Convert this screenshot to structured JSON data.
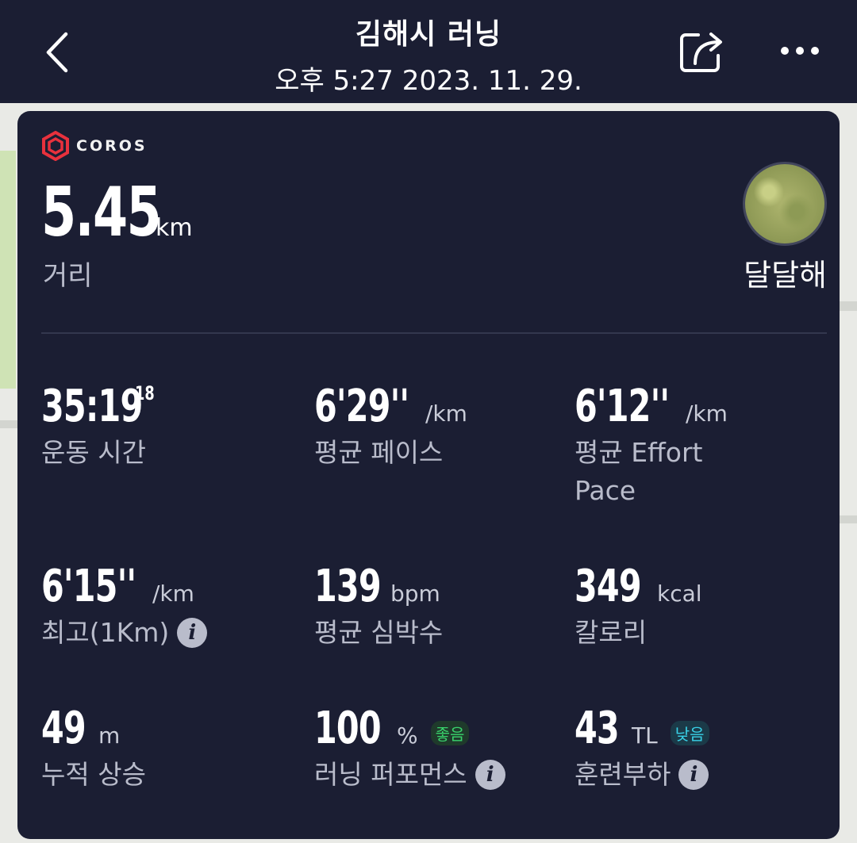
{
  "header": {
    "title": "김해시 러닝",
    "subtitle": "오후 5:27 2023. 11. 29."
  },
  "card": {
    "brand": "COROS",
    "brand_color": "#e8313d",
    "distance": {
      "value": "5.45",
      "unit": "km",
      "label": "거리"
    },
    "user": {
      "name": "달달해"
    },
    "stats": [
      {
        "value": "35:19",
        "sup": "18",
        "unit": "",
        "label": "운동 시간"
      },
      {
        "value": "6'29''",
        "unit": "/km",
        "label": "평균 페이스"
      },
      {
        "value": "6'12''",
        "unit": "/km",
        "label_line1": "평균 Effort",
        "label_line2": "Pace"
      },
      {
        "value": "6'15''",
        "unit": "/km",
        "label": "최고(1Km)"
      },
      {
        "value": "139",
        "unit": "bpm",
        "label": "평균 심박수"
      },
      {
        "value": "349",
        "unit": "kcal",
        "label": "칼로리"
      },
      {
        "value": "49",
        "unit": "m",
        "label": "누적 상승"
      },
      {
        "value": "100",
        "unit": "%",
        "badge": "좋음",
        "label": "러닝 퍼포먼스"
      },
      {
        "value": "43",
        "unit": "TL",
        "badge": "낮음",
        "label": "훈련부하"
      }
    ]
  },
  "colors": {
    "header_bg": "#1b1e33",
    "card_bg": "#1b1e33",
    "badge_good": "#39d36c",
    "badge_low": "#39d0e6"
  }
}
